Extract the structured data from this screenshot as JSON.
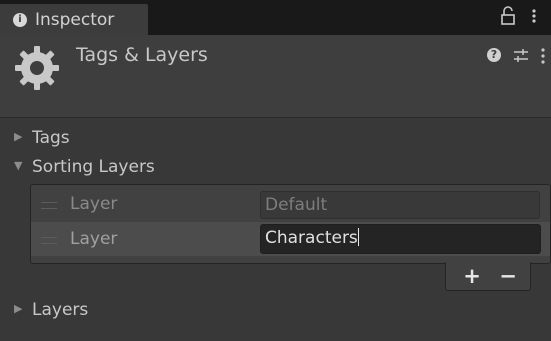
{
  "window": {
    "tab_title": "Inspector",
    "tab_info_glyph": "i"
  },
  "header": {
    "title": "Tags & Layers",
    "help_glyph": "?"
  },
  "sections": {
    "tags": {
      "label": "Tags",
      "arrow": "▶",
      "expanded": false
    },
    "sorting_layers": {
      "label": "Sorting Layers",
      "arrow": "▼",
      "expanded": true
    },
    "layers": {
      "label": "Layers",
      "arrow": "▶",
      "expanded": false
    }
  },
  "sorting_layer_list": {
    "rows": [
      {
        "label": "Layer",
        "value": "Default",
        "editable": false
      },
      {
        "label": "Layer",
        "value": "Characters",
        "editable": true,
        "selected": true
      }
    ],
    "add_label": "+",
    "remove_label": "−"
  },
  "icons": {
    "tab_info": "info-icon",
    "lock": "lock-icon",
    "tab_menu": "kebab-icon",
    "component": "gear-icon",
    "help": "help-icon",
    "presets": "presets-sliders-icon",
    "header_menu": "kebab-icon"
  },
  "colors": {
    "panel_bg": "#383838",
    "tab_strip": "#191919",
    "active_field_bg": "#242424",
    "text": "#c4c4c4"
  }
}
